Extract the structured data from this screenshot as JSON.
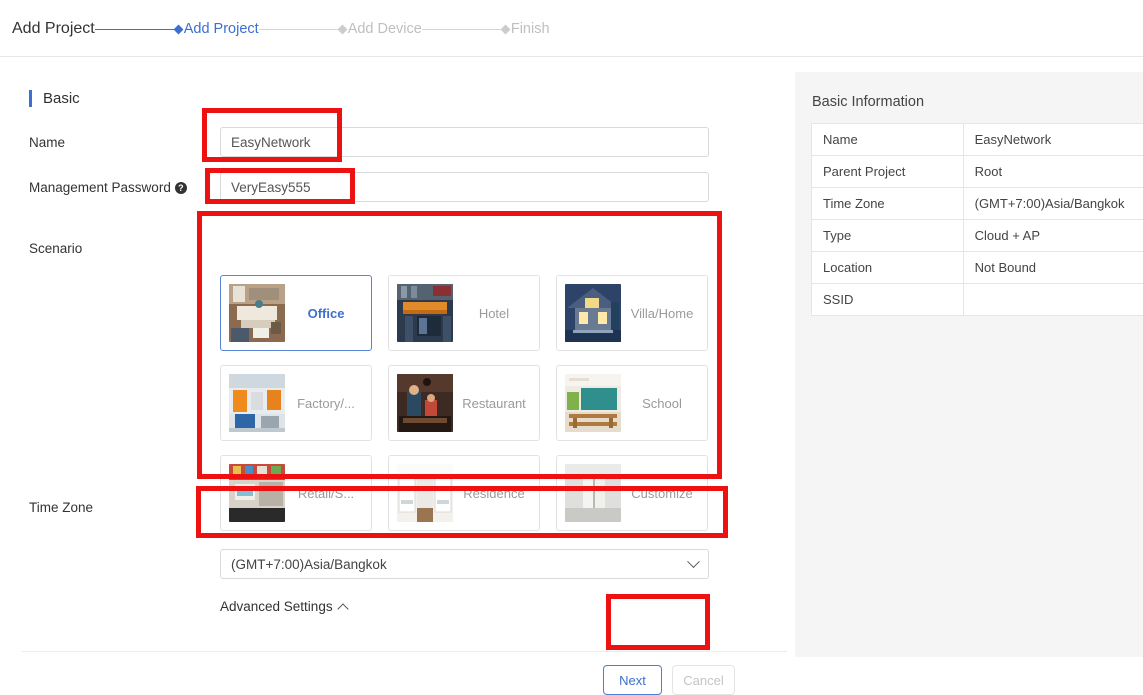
{
  "header": {
    "page_title": "Add Project",
    "steps": [
      {
        "label": "Add Project",
        "state": "active"
      },
      {
        "label": "Add Device",
        "state": "inactive"
      },
      {
        "label": "Finish",
        "state": "inactive"
      }
    ]
  },
  "form": {
    "section_title": "Basic",
    "name_label": "Name",
    "name_value": "EasyNetwork",
    "name_placeholder": "",
    "password_label": "Management Password",
    "password_help_icon": "question-mark-icon",
    "password_value": "VeryEasy555",
    "password_placeholder": "",
    "scenario_label": "Scenario",
    "scenarios": [
      {
        "name": "Office",
        "selected": true
      },
      {
        "name": "Hotel",
        "selected": false
      },
      {
        "name": "Villa/Home",
        "selected": false
      },
      {
        "name": "Factory/...",
        "selected": false
      },
      {
        "name": "Restaurant",
        "selected": false
      },
      {
        "name": "School",
        "selected": false
      },
      {
        "name": "Retail/S...",
        "selected": false
      },
      {
        "name": "Residence",
        "selected": false
      },
      {
        "name": "Customize",
        "selected": false
      }
    ],
    "timezone_label": "Time Zone",
    "timezone_value": "(GMT+7:00)Asia/Bangkok",
    "advanced_settings_label": "Advanced Settings",
    "next_label": "Next",
    "cancel_label": "Cancel"
  },
  "info_panel": {
    "title": "Basic Information",
    "rows": [
      {
        "key": "Name",
        "value": "EasyNetwork"
      },
      {
        "key": "Parent Project",
        "value": "Root"
      },
      {
        "key": "Time Zone",
        "value": "(GMT+7:00)Asia/Bangkok"
      },
      {
        "key": "Type",
        "value": "Cloud + AP"
      },
      {
        "key": "Location",
        "value": "Not Bound"
      },
      {
        "key": "SSID",
        "value": ""
      }
    ]
  },
  "colors": {
    "accent_blue": "#3c6fd0",
    "annotation_red": "#ee1111",
    "muted_gray": "#bfbfbf",
    "panel_gray": "#f5f5f5"
  }
}
